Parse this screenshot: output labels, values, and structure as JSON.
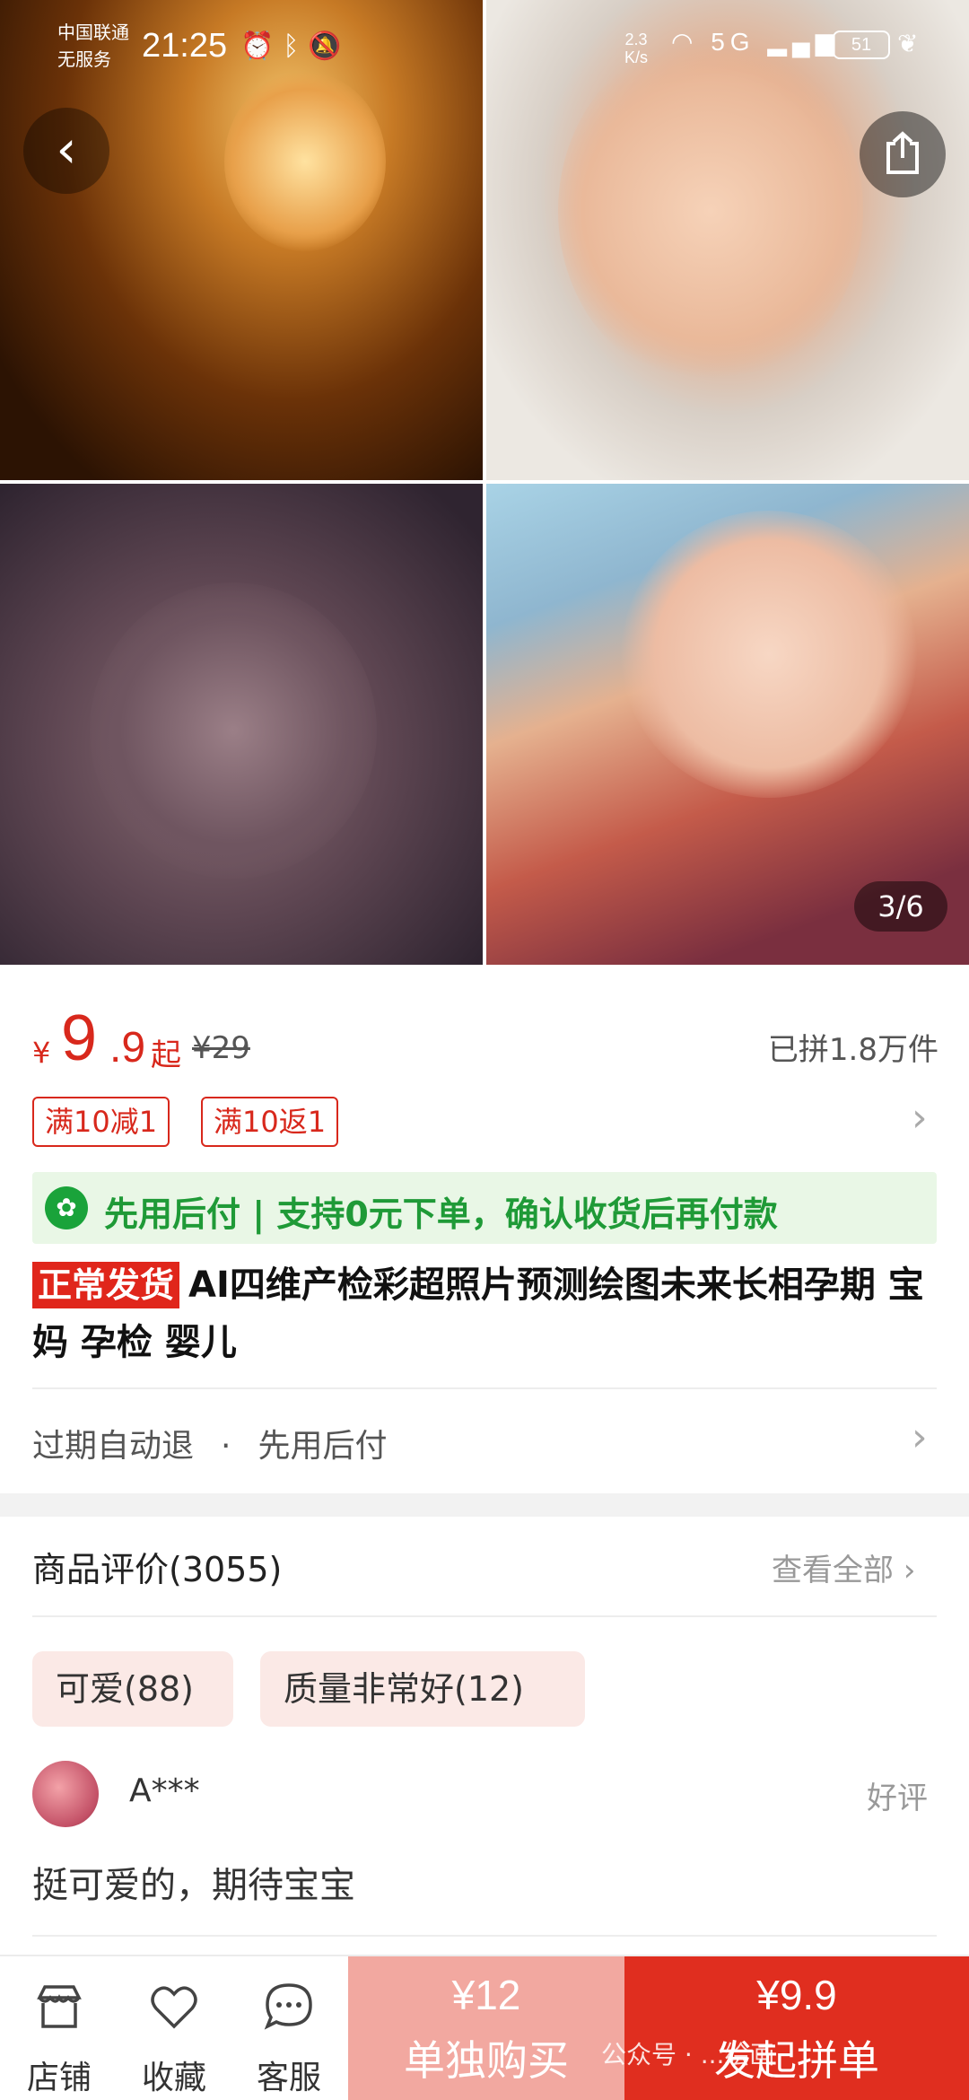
{
  "status_bar": {
    "carrier_line1": "中国联通",
    "carrier_line2": "无服务",
    "time": "21:25",
    "net_speed_value": "2.3",
    "net_speed_unit": "K/s",
    "network": "5G",
    "battery": "51"
  },
  "gallery": {
    "page_indicator": "3/6",
    "back_icon": "chevron-left-icon",
    "share_icon": "share-icon"
  },
  "price": {
    "currency": "¥",
    "integer": "9",
    "decimal": ".9",
    "suffix": "起",
    "original": "¥29",
    "sold": "已拼1.8万件",
    "color": "#d8281c"
  },
  "coupons": [
    "满10减1",
    "满10返1"
  ],
  "pay_later": {
    "text": "先用后付 | 支持0元下单，确认收货后再付款",
    "color": "#1f9a37"
  },
  "product": {
    "badge": "正常发货",
    "title": "AI四维产检彩超照片预测绘图未来长相孕期 宝妈 孕检 婴儿"
  },
  "services": {
    "item1": "过期自动退",
    "separator": "·",
    "item2": "先用后付"
  },
  "reviews": {
    "header": "商品评价(3055)",
    "view_all": "查看全部",
    "tags": [
      "可爱(88)",
      "质量非常好(12)"
    ],
    "first": {
      "user": "A***",
      "rating": "好评",
      "text": "挺可爱的，期待宝宝"
    }
  },
  "bottom_bar": {
    "store_label": "店铺",
    "favorite_label": "收藏",
    "service_label": "客服",
    "solo_price": "¥12",
    "solo_label": "单独购买",
    "group_price": "¥9.9",
    "group_label": "发起拼单",
    "group_color": "#e02e1f",
    "solo_color": "#f2a8a0"
  },
  "watermark": "公众号 · ...绘画"
}
